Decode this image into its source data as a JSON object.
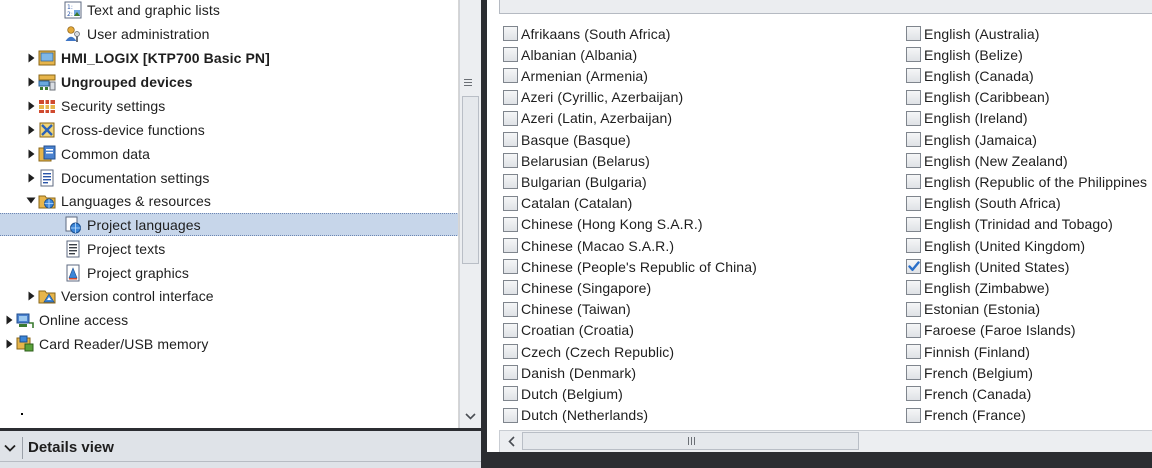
{
  "tree": {
    "items": [
      {
        "label": "Text and graphic lists",
        "level": 2,
        "expander": "none",
        "icon": "text-graphic-lists-icon",
        "bold": false,
        "selected": false
      },
      {
        "label": "User administration",
        "level": 2,
        "expander": "none",
        "icon": "user-administration-icon",
        "bold": false,
        "selected": false
      },
      {
        "label": "HMI_LOGIX [KTP700 Basic PN]",
        "level": 1,
        "expander": "collapsed",
        "icon": "hmi-device-icon",
        "bold": true,
        "selected": false
      },
      {
        "label": "Ungrouped devices",
        "level": 1,
        "expander": "collapsed",
        "icon": "ungrouped-devices-icon",
        "bold": true,
        "selected": false
      },
      {
        "label": "Security settings",
        "level": 1,
        "expander": "collapsed",
        "icon": "security-settings-icon",
        "bold": false,
        "selected": false
      },
      {
        "label": "Cross-device functions",
        "level": 1,
        "expander": "collapsed",
        "icon": "cross-device-functions-icon",
        "bold": false,
        "selected": false
      },
      {
        "label": "Common data",
        "level": 1,
        "expander": "collapsed",
        "icon": "common-data-icon",
        "bold": false,
        "selected": false
      },
      {
        "label": "Documentation settings",
        "level": 1,
        "expander": "collapsed",
        "icon": "documentation-settings-icon",
        "bold": false,
        "selected": false
      },
      {
        "label": "Languages & resources",
        "level": 1,
        "expander": "expanded",
        "icon": "languages-resources-icon",
        "bold": false,
        "selected": false
      },
      {
        "label": "Project languages",
        "level": 2,
        "expander": "none",
        "icon": "project-languages-icon",
        "bold": false,
        "selected": true
      },
      {
        "label": "Project texts",
        "level": 2,
        "expander": "none",
        "icon": "project-texts-icon",
        "bold": false,
        "selected": false
      },
      {
        "label": "Project graphics",
        "level": 2,
        "expander": "none",
        "icon": "project-graphics-icon",
        "bold": false,
        "selected": false
      },
      {
        "label": "Version control interface",
        "level": 1,
        "expander": "collapsed",
        "icon": "version-control-icon",
        "bold": false,
        "selected": false
      },
      {
        "label": "Online access",
        "level": 0,
        "expander": "collapsed",
        "icon": "online-access-icon",
        "bold": false,
        "selected": false
      },
      {
        "label": "Card Reader/USB memory",
        "level": 0,
        "expander": "collapsed",
        "icon": "card-reader-icon",
        "bold": false,
        "selected": false
      }
    ]
  },
  "details": {
    "title": "Details view"
  },
  "languages": {
    "columns": [
      [
        {
          "label": "Afrikaans (South Africa)",
          "checked": false
        },
        {
          "label": "Albanian (Albania)",
          "checked": false
        },
        {
          "label": "Armenian (Armenia)",
          "checked": false
        },
        {
          "label": "Azeri (Cyrillic, Azerbaijan)",
          "checked": false
        },
        {
          "label": "Azeri (Latin, Azerbaijan)",
          "checked": false
        },
        {
          "label": "Basque (Basque)",
          "checked": false
        },
        {
          "label": "Belarusian (Belarus)",
          "checked": false
        },
        {
          "label": "Bulgarian (Bulgaria)",
          "checked": false
        },
        {
          "label": "Catalan (Catalan)",
          "checked": false
        },
        {
          "label": "Chinese (Hong Kong S.A.R.)",
          "checked": false
        },
        {
          "label": "Chinese (Macao S.A.R.)",
          "checked": false
        },
        {
          "label": "Chinese (People's Republic of China)",
          "checked": false
        },
        {
          "label": "Chinese (Singapore)",
          "checked": false
        },
        {
          "label": "Chinese (Taiwan)",
          "checked": false
        },
        {
          "label": "Croatian (Croatia)",
          "checked": false
        },
        {
          "label": "Czech (Czech Republic)",
          "checked": false
        },
        {
          "label": "Danish (Denmark)",
          "checked": false
        },
        {
          "label": "Dutch (Belgium)",
          "checked": false
        },
        {
          "label": "Dutch (Netherlands)",
          "checked": false
        }
      ],
      [
        {
          "label": "English (Australia)",
          "checked": false
        },
        {
          "label": "English (Belize)",
          "checked": false
        },
        {
          "label": "English (Canada)",
          "checked": false
        },
        {
          "label": "English (Caribbean)",
          "checked": false
        },
        {
          "label": "English (Ireland)",
          "checked": false
        },
        {
          "label": "English (Jamaica)",
          "checked": false
        },
        {
          "label": "English (New Zealand)",
          "checked": false
        },
        {
          "label": "English (Republic of the Philippines",
          "checked": false
        },
        {
          "label": "English (South Africa)",
          "checked": false
        },
        {
          "label": "English (Trinidad and Tobago)",
          "checked": false
        },
        {
          "label": "English (United Kingdom)",
          "checked": false
        },
        {
          "label": "English (United States)",
          "checked": true
        },
        {
          "label": "English (Zimbabwe)",
          "checked": false
        },
        {
          "label": "Estonian (Estonia)",
          "checked": false
        },
        {
          "label": "Faroese (Faroe Islands)",
          "checked": false
        },
        {
          "label": "Finnish (Finland)",
          "checked": false
        },
        {
          "label": "French (Belgium)",
          "checked": false
        },
        {
          "label": "French (Canada)",
          "checked": false
        },
        {
          "label": "French (France)",
          "checked": false
        }
      ]
    ]
  },
  "colors": {
    "selection_bg": "#c7d6ea",
    "checkmark": "#2a6fc9",
    "dark_frame": "#2b2d31"
  }
}
